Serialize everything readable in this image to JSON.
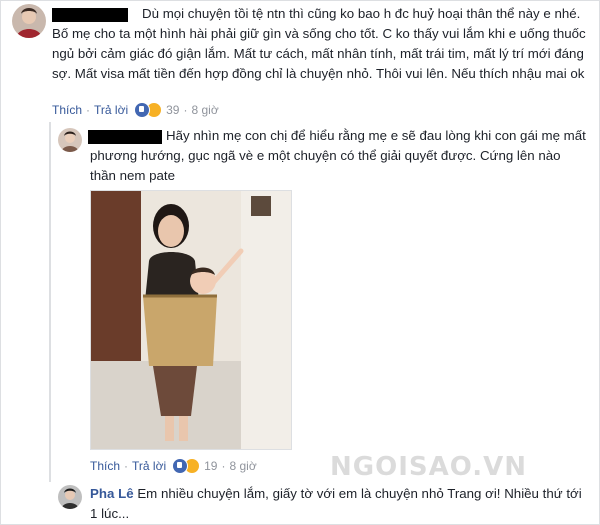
{
  "comments": [
    {
      "text": "Dù mọi chuyện tồi tệ ntn thì cũng ko bao h đc huỷ hoại thân thể này e nhé. Bố mẹ cho ta một hình hài phải giữ gìn và sống cho tốt. C ko thấy vui lắm khi e uống thuốc ngủ bởi cảm giác đó giận lắm. Mất tư cách, mất nhân tính, mất trái tim, mất lý trí mới đáng sợ. Mất visa mất tiền đến hợp đồng chỉ là chuyện nhỏ. Thôi vui lên. Nếu thích nhậu mai ok",
      "like_label": "Thích",
      "reply_label": "Trả lời",
      "reaction_count": "39",
      "time": "8 giờ"
    },
    {
      "text": "Hãy nhìn mẹ con chị để hiểu rằng mẹ e sẽ đau lòng khi con gái mẹ mất phương hướng, gục ngã vè e một chuyện có thể giải quyết được. Cứng lên nào thần nem pate",
      "like_label": "Thích",
      "reply_label": "Trả lời",
      "reaction_count": "19",
      "time": "8 giờ"
    },
    {
      "name": "Pha Lê",
      "text": "Em nhiều chuyện lắm, giấy tờ với em là chuyện nhỏ Trang ơi! Nhiều thứ tới 1 lúc..."
    }
  ],
  "watermark": "NGOISAO.VN",
  "colors": {
    "link": "#365899",
    "meta": "#90949c",
    "like": "#4267b2",
    "haha": "#f7b125"
  }
}
